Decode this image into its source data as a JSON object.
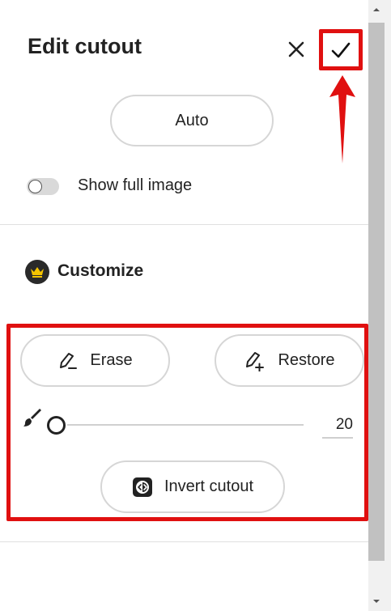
{
  "header": {
    "title": "Edit cutout"
  },
  "auto": {
    "label": "Auto"
  },
  "toggle": {
    "label": "Show full image",
    "on": false
  },
  "customize": {
    "label": "Customize"
  },
  "tools": {
    "erase_label": "Erase",
    "restore_label": "Restore"
  },
  "brush": {
    "size_value": "20"
  },
  "invert": {
    "label": "Invert cutout"
  },
  "colors": {
    "highlight": "#e01010",
    "crown": "#f5c400"
  }
}
